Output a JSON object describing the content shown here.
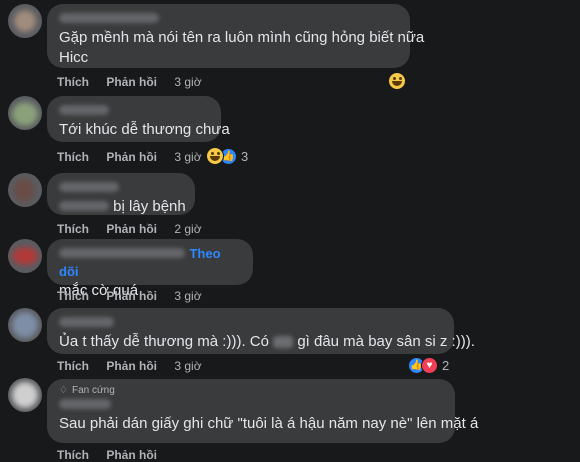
{
  "labels": {
    "like": "Thích",
    "reply": "Phản hồi",
    "follow": "Theo dõi",
    "fan_badge": "Fan cứng"
  },
  "comments": [
    {
      "lines": [
        "Gặp mềnh mà nói tên ra luôn mình cũng hỏng biết nữa",
        "Hicc"
      ],
      "time": "3 giờ",
      "reaction_count": ""
    },
    {
      "lines": [
        "Tới khúc dễ thương chưa"
      ],
      "time": "3 giờ",
      "reaction_count": "3"
    },
    {
      "lines": [
        "bị lây bệnh"
      ],
      "time": "2 giờ",
      "reaction_count": ""
    },
    {
      "lines": [
        "mắc cờ quá"
      ],
      "time": "3 giờ",
      "reaction_count": ""
    },
    {
      "lines": [
        "Ủa t thấy dễ thương mà :))). Có",
        "gì đâu mà bay sân si z :)))."
      ],
      "time": "3 giờ",
      "reaction_count": "2"
    },
    {
      "lines": [
        "Sau phải dán giấy ghi chữ \"tuôi là á hậu năm nay nè\" lên mặt á"
      ],
      "time": "",
      "reaction_count": ""
    }
  ],
  "colors": {
    "background": "#18191a",
    "bubble": "#3a3b3c",
    "accent": "#2d88ff",
    "love": "#f33e58"
  },
  "icons": [
    "haha-emoji-icon",
    "like-reaction-icon",
    "love-reaction-icon",
    "fan-badge-icon"
  ]
}
